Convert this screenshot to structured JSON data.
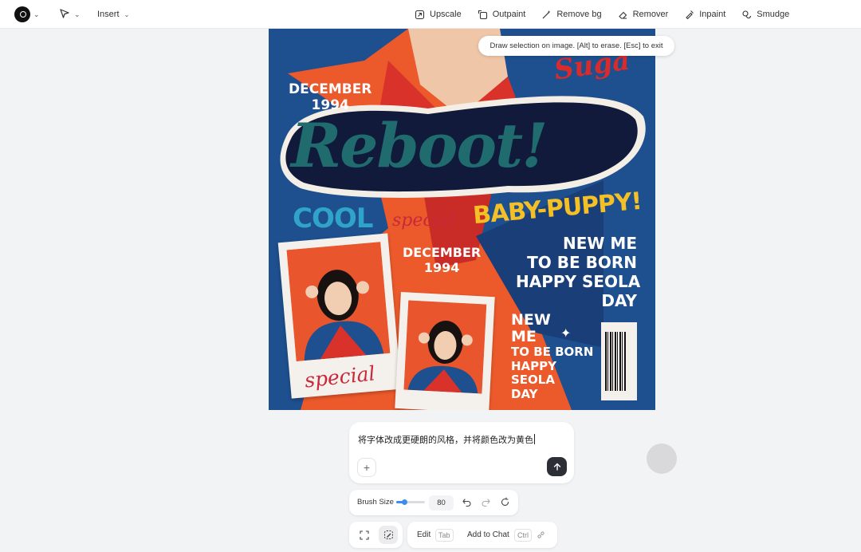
{
  "toolbar": {
    "insert_label": "Insert",
    "tools": [
      {
        "label": "Upscale",
        "icon": "upscale-icon"
      },
      {
        "label": "Outpaint",
        "icon": "outpaint-icon"
      },
      {
        "label": "Remove bg",
        "icon": "remove-bg-icon"
      },
      {
        "label": "Remover",
        "icon": "eraser-icon"
      },
      {
        "label": "Inpaint",
        "icon": "inpaint-icon"
      },
      {
        "label": "Smudge",
        "icon": "smudge-icon"
      }
    ]
  },
  "hint": "Draw selection on image. [Alt] to erase. [Esc] to exit",
  "poster": {
    "date_top_month": "DECEMBER",
    "date_top_year": "1994",
    "headline": "Reboot!",
    "suga": "Suga",
    "cool": "COOL",
    "special_small": "special",
    "baby_puppy": "BABY-PUPPY!",
    "date_mid_month": "DECEMBER",
    "date_mid_year": "1994",
    "right_lines": [
      "NEW ME",
      "TO BE BORN",
      "HAPPY SEOLA",
      "DAY"
    ],
    "right2_lines": [
      "NEW",
      "ME",
      "TO BE BORN",
      "HAPPY",
      "SEOLA",
      "DAY"
    ],
    "special_polaroid": "special"
  },
  "chat": {
    "input_text": "将字体改成更硬朗的风格，并将颜色改为黄色"
  },
  "brush": {
    "label": "Brush Size",
    "value": "80",
    "slider_fraction": 0.28
  },
  "actions": {
    "edit_label": "Edit",
    "edit_key": "Tab",
    "add_label": "Add to Chat",
    "add_key": "Ctrl"
  },
  "colors": {
    "accent": "#3b8df0",
    "poster_orange": "#ec5a2c",
    "poster_blue": "#1e4f8f",
    "send_button": "#2d2f36"
  }
}
